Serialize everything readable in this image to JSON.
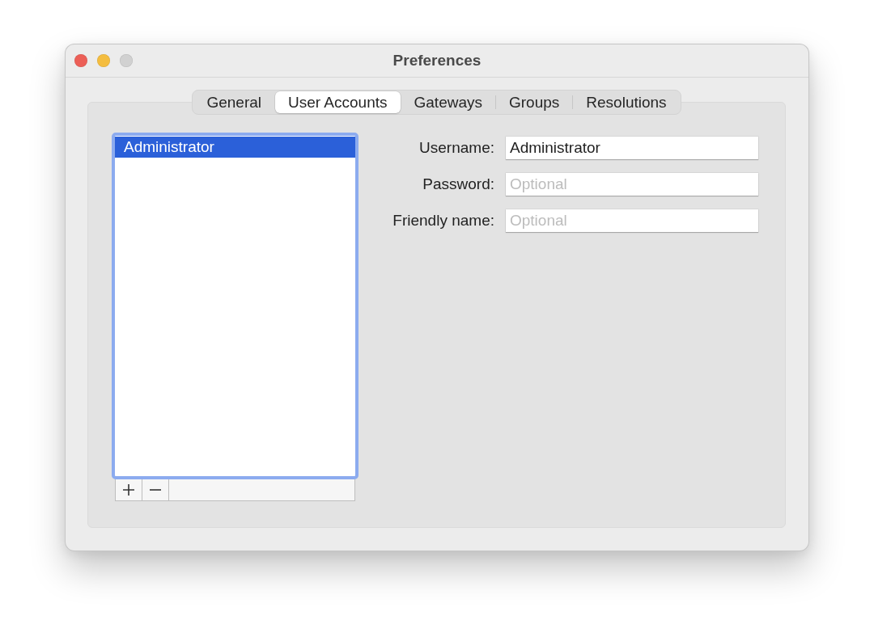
{
  "window": {
    "title": "Preferences",
    "controls": [
      {
        "kind": "close",
        "disabled": false
      },
      {
        "kind": "minimize",
        "disabled": false
      },
      {
        "kind": "zoom",
        "disabled": true
      }
    ]
  },
  "tabs": [
    {
      "label": "General",
      "selected": false
    },
    {
      "label": "User Accounts",
      "selected": true
    },
    {
      "label": "Gateways",
      "selected": false
    },
    {
      "label": "Groups",
      "selected": false
    },
    {
      "label": "Resolutions",
      "selected": false
    }
  ],
  "accounts": {
    "items": [
      {
        "name": "Administrator",
        "selected": true
      }
    ]
  },
  "form": {
    "fields": [
      {
        "label": "Username:",
        "value": "Administrator"
      },
      {
        "label": "Password:",
        "placeholder": "Optional"
      },
      {
        "label": "Friendly name:",
        "placeholder": "Optional"
      }
    ]
  }
}
